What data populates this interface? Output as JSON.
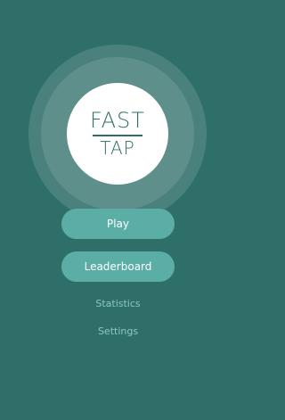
{
  "logo": {
    "top": "FAST",
    "bottom": "TAP"
  },
  "menu": {
    "play_label": "Play",
    "leaderboard_label": "Leaderboard",
    "statistics_label": "Statistics",
    "settings_label": "Settings"
  },
  "colors": {
    "background": "#2f6f6a",
    "button_fill": "#5aaea5",
    "logo_circle": "#ffffff",
    "secondary_text": "#8fc6bf"
  }
}
